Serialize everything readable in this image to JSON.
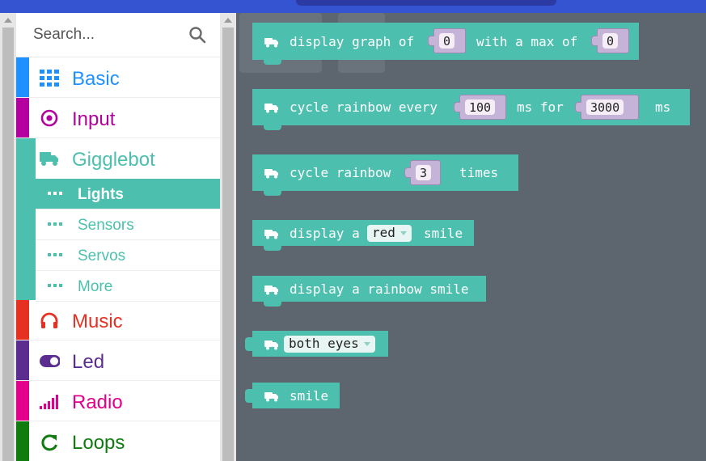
{
  "search": {
    "placeholder": "Search..."
  },
  "categories": [
    {
      "label": "Basic",
      "color": "#1e90ff"
    },
    {
      "label": "Input",
      "color": "#b4009e"
    },
    {
      "label": "Gigglebot",
      "color": "#4cbfae"
    },
    {
      "label": "Music",
      "color": "#e63022"
    },
    {
      "label": "Led",
      "color": "#5c2d91"
    },
    {
      "label": "Radio",
      "color": "#e3008c"
    },
    {
      "label": "Loops",
      "color": "#107c10"
    }
  ],
  "subcategories": [
    {
      "label": "Lights",
      "active": true
    },
    {
      "label": "Sensors"
    },
    {
      "label": "Servos"
    },
    {
      "label": "More"
    }
  ],
  "blocks": {
    "graph": {
      "part1": "display graph of",
      "value1": "0",
      "part2": "with a max of",
      "value2": "0"
    },
    "cycle_every": {
      "part1": "cycle rainbow every",
      "value1": "100",
      "part2": "ms for",
      "value2": "3000",
      "part3": "ms"
    },
    "cycle_times": {
      "part1": "cycle rainbow",
      "value1": "3",
      "part2": "times"
    },
    "smile_color": {
      "part1": "display a",
      "dropdown": "red",
      "part2": "smile"
    },
    "rainbow_smile": {
      "label": "display a rainbow smile"
    },
    "both_eyes": {
      "dropdown": "both eyes"
    },
    "smile": {
      "label": "smile"
    }
  },
  "colors": {
    "gigglebot": "#4cbfae",
    "workspace": "#5d666f",
    "topbar": "#3454d1"
  }
}
